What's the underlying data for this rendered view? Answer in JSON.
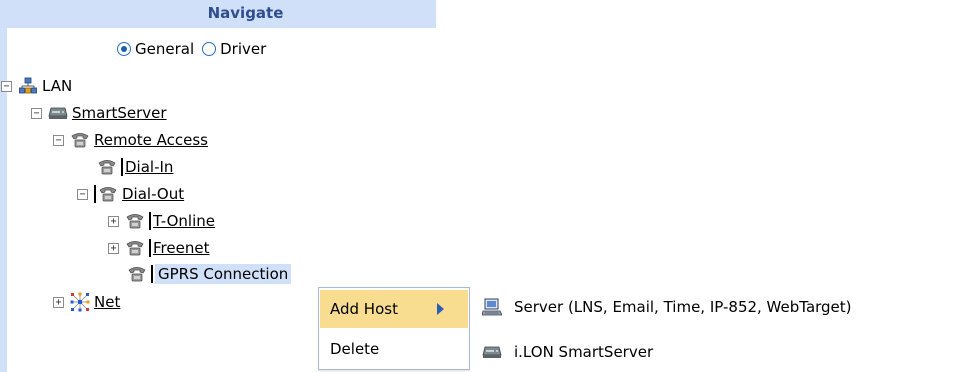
{
  "nav": {
    "header": "Navigate",
    "radio_general": "General",
    "radio_driver": "Driver",
    "selected_radio": "General"
  },
  "tree": {
    "lan": "LAN",
    "smartserver": "SmartServer",
    "remote_access": "Remote Access",
    "dial_in": "Dial-In",
    "dial_out": "Dial-Out",
    "t_online": "T-Online",
    "freenet": "Freenet",
    "gprs": "GPRS Connection",
    "net": "Net",
    "collapse_symbol": "−",
    "expand_symbol": "+"
  },
  "context_menu": {
    "add_host": "Add Host",
    "delete": "Delete"
  },
  "sub_menu": {
    "server": "Server (LNS, Email, Time, IP-852, WebTarget)",
    "ilon": "i.LON SmartServer"
  },
  "icons": {
    "lan": "network-tree-icon",
    "smartserver": "smartserver-device-icon",
    "phone": "telephone-icon",
    "net": "net-grid-icon",
    "server": "computer-server-icon",
    "ilon": "smartserver-device-icon"
  },
  "colors": {
    "nav_header_bg": "#cfe0f8",
    "nav_header_text": "#2f4e8f",
    "menu_highlight": "#f8dc8f",
    "arrow": "#2b5fb6"
  }
}
